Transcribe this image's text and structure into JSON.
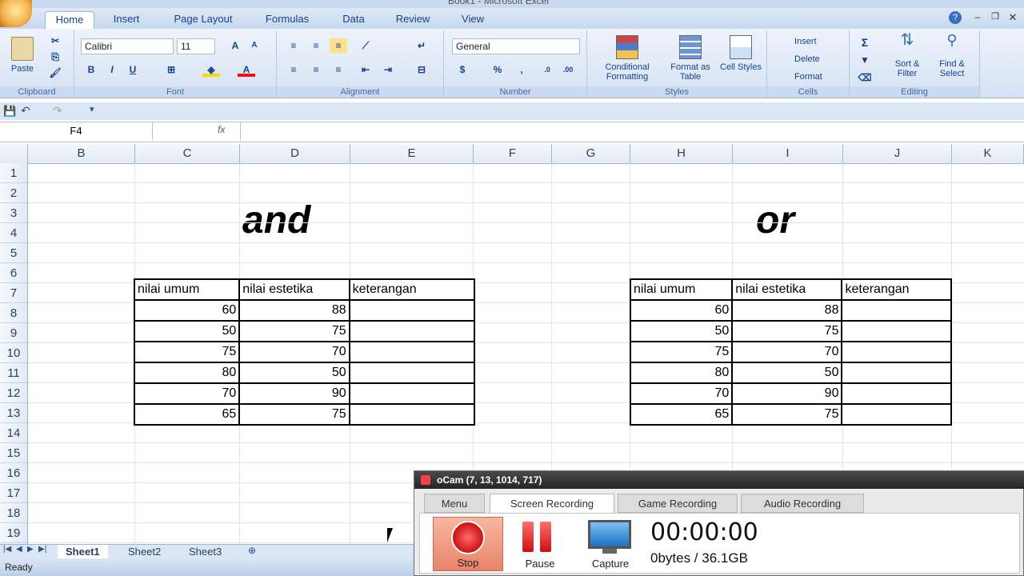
{
  "ribbon": {
    "tabs": [
      "Home",
      "Insert",
      "Page Layout",
      "Formulas",
      "Data",
      "Review",
      "View"
    ],
    "title_text": "Book1 - Microsoft Excel",
    "clipboard": {
      "paste": "Paste",
      "label": "Clipboard"
    },
    "font": {
      "name": "Calibri",
      "size": "11",
      "label": "Font"
    },
    "alignment": {
      "label": "Alignment"
    },
    "number": {
      "format": "General",
      "label": "Number",
      "currency": "$",
      "percent": "%"
    },
    "styles": {
      "conditional": "Conditional Formatting",
      "format_table": "Format as Table",
      "cell_styles": "Cell Styles",
      "label": "Styles"
    },
    "cells": {
      "insert": "Insert",
      "delete": "Delete",
      "format": "Format",
      "label": "Cells"
    },
    "editing": {
      "sigma": "Σ",
      "sort": "Sort & Filter",
      "find": "Find & Select",
      "label": "Editing"
    }
  },
  "formula_bar": {
    "name_box": "F4",
    "fx": "fx",
    "value": ""
  },
  "columns": [
    "B",
    "C",
    "D",
    "E",
    "F",
    "G",
    "H",
    "I",
    "J",
    "K"
  ],
  "rows": [
    "1",
    "2",
    "3",
    "4",
    "5",
    "6",
    "7",
    "8",
    "9",
    "10",
    "11",
    "12",
    "13",
    "14",
    "15",
    "16",
    "17",
    "18",
    "19"
  ],
  "sheet": {
    "title_and": "and",
    "title_or": "or",
    "headers": [
      "nilai umum",
      "nilai estetika",
      "keterangan"
    ],
    "table_and": [
      [
        "60",
        "88",
        ""
      ],
      [
        "50",
        "75",
        ""
      ],
      [
        "75",
        "70",
        ""
      ],
      [
        "80",
        "50",
        ""
      ],
      [
        "70",
        "90",
        ""
      ],
      [
        "65",
        "75",
        ""
      ]
    ],
    "table_or": [
      [
        "60",
        "88",
        ""
      ],
      [
        "50",
        "75",
        ""
      ],
      [
        "75",
        "70",
        ""
      ],
      [
        "80",
        "50",
        ""
      ],
      [
        "70",
        "90",
        ""
      ],
      [
        "65",
        "75",
        ""
      ]
    ]
  },
  "sheet_tabs": [
    "Sheet1",
    "Sheet2",
    "Sheet3"
  ],
  "status": "Ready",
  "ocam": {
    "title": "oCam (7, 13, 1014, 717)",
    "tabs": [
      "Menu",
      "Screen Recording",
      "Game Recording",
      "Audio Recording"
    ],
    "stop": "Stop",
    "pause": "Pause",
    "capture": "Capture",
    "timer": "00:00:00",
    "size": "0bytes / 36.1GB"
  }
}
